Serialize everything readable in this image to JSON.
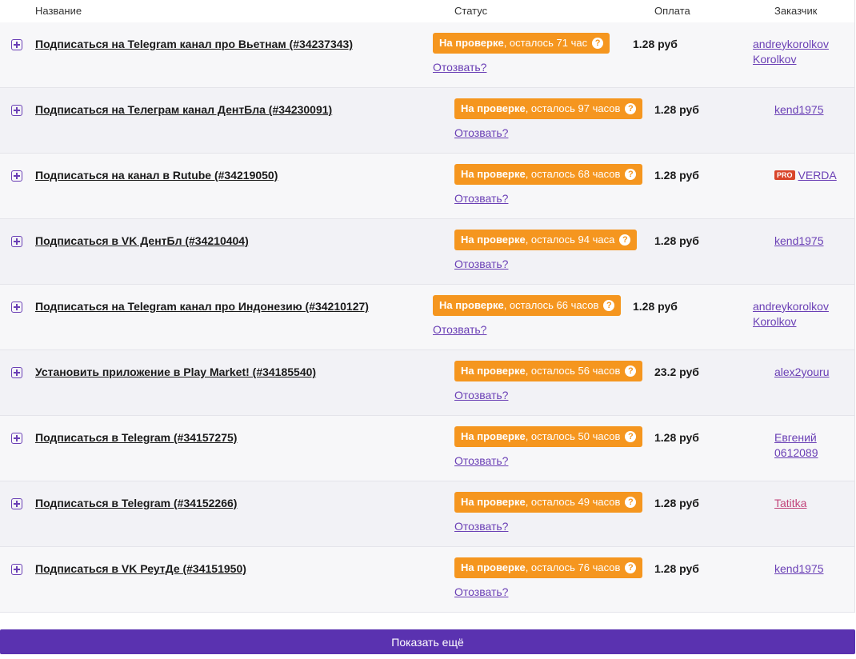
{
  "table": {
    "headers": {
      "name": "Название",
      "status": "Статус",
      "payment": "Оплата",
      "customer": "Заказчик"
    },
    "rows": [
      {
        "title": "Подписаться на Telegram канал про Вьетнам (#34237343)",
        "status_bold": "На проверке",
        "status_rest": ", осталось 71 час",
        "withdraw": "Отозвать?",
        "price": "1.28 руб",
        "customer_line1": "andreykorolkov",
        "customer_line2": "Korolkov",
        "pro": "",
        "layout": "wide"
      },
      {
        "title": "Подписаться на Телеграм канал ДентБла (#34230091)",
        "status_bold": "На проверке",
        "status_rest": ", осталось 97 часов",
        "withdraw": "Отозвать?",
        "price": "1.28 руб",
        "customer_line1": "kend1975",
        "customer_line2": "",
        "pro": "",
        "layout": "narrow"
      },
      {
        "title": "Подписаться на канал в Rutube (#34219050)",
        "status_bold": "На проверке",
        "status_rest": ", осталось 68 часов",
        "withdraw": "Отозвать?",
        "price": "1.28 руб",
        "customer_line1": "VERDA",
        "customer_line2": "",
        "pro": "PRO",
        "layout": "narrow"
      },
      {
        "title": "Подписаться в VK ДентБл (#34210404)",
        "status_bold": "На проверке",
        "status_rest": ", осталось 94 часа",
        "withdraw": "Отозвать?",
        "price": "1.28 руб",
        "customer_line1": "kend1975",
        "customer_line2": "",
        "pro": "",
        "layout": "narrow"
      },
      {
        "title": "Подписаться на Telegram канал про Индонезию (#34210127)",
        "status_bold": "На проверке",
        "status_rest": ", осталось 66 часов",
        "withdraw": "Отозвать?",
        "price": "1.28 руб",
        "customer_line1": "andreykorolkov",
        "customer_line2": "Korolkov",
        "pro": "",
        "layout": "wide"
      },
      {
        "title": "Установить приложение в Play Market! (#34185540)",
        "status_bold": "На проверке",
        "status_rest": ", осталось 56 часов",
        "withdraw": "Отозвать?",
        "price": "23.2 руб",
        "customer_line1": "alex2youru",
        "customer_line2": "",
        "pro": "",
        "layout": "narrow"
      },
      {
        "title": "Подписаться в Telegram (#34157275)",
        "status_bold": "На проверке",
        "status_rest": ", осталось 50 часов",
        "withdraw": "Отозвать?",
        "price": "1.28 руб",
        "customer_line1": "Евгений",
        "customer_line2": "0612089",
        "pro": "",
        "layout": "narrow"
      },
      {
        "title": "Подписаться в Telegram (#34152266)",
        "status_bold": "На проверке",
        "status_rest": ", осталось 49 часов",
        "withdraw": "Отозвать?",
        "price": "1.28 руб",
        "customer_line1": "Tatitka",
        "customer_line2": "",
        "pro": "",
        "layout": "narrow",
        "customer_color": "pink"
      },
      {
        "title": "Подписаться в VK РеутДе (#34151950)",
        "status_bold": "На проверке",
        "status_rest": ", осталось 76 часов",
        "withdraw": "Отозвать?",
        "price": "1.28 руб",
        "customer_line1": "kend1975",
        "customer_line2": "",
        "pro": "",
        "layout": "narrow"
      }
    ]
  },
  "footer": {
    "more_label": "Показать ещё"
  },
  "colors": {
    "accent": "#5a32b0",
    "status_orange": "#f5961f",
    "link_purple": "#6a3fb5",
    "pro_red": "#d9452a"
  },
  "icons": {
    "expand": "plus-square-icon",
    "help": "question-circle-icon"
  }
}
